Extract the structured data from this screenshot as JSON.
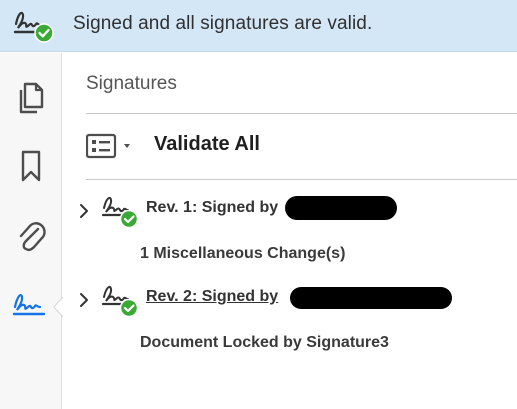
{
  "banner": {
    "message": "Signed and all signatures are valid.",
    "icon": "signature-valid-icon",
    "color": "#d4e7f7"
  },
  "rail": {
    "tools": [
      {
        "name": "pages-icon"
      },
      {
        "name": "bookmark-icon"
      },
      {
        "name": "attachment-icon"
      },
      {
        "name": "signature-panel-icon",
        "active": true
      }
    ]
  },
  "panel": {
    "title": "Signatures",
    "validate_all": "Validate All",
    "options_icon": "list-options-icon",
    "revisions": [
      {
        "label": "Rev. 1: Signed by",
        "detail": "1 Miscellaneous Change(s)",
        "status": "valid"
      },
      {
        "label": "Rev. 2: Signed by",
        "detail": "Document Locked by Signature3",
        "status": "valid"
      }
    ]
  },
  "colors": {
    "valid_green": "#3aa935",
    "active_blue": "#1473e6"
  }
}
